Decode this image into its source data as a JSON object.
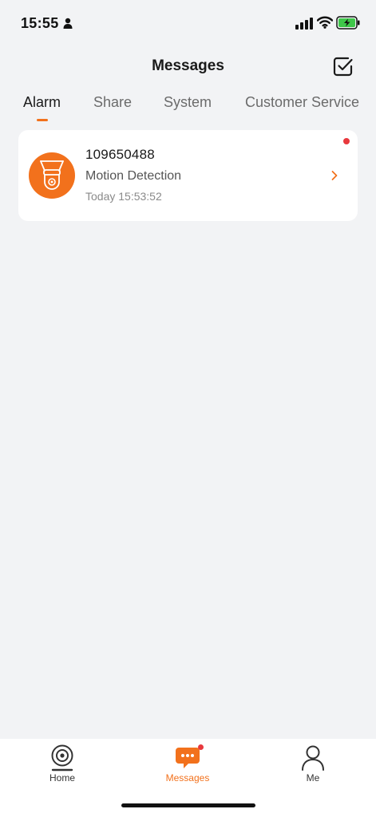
{
  "status_bar": {
    "time": "15:55"
  },
  "header": {
    "title": "Messages"
  },
  "tabs": [
    {
      "label": "Alarm",
      "active": true
    },
    {
      "label": "Share",
      "active": false
    },
    {
      "label": "System",
      "active": false
    },
    {
      "label": "Customer Service",
      "active": false
    }
  ],
  "messages": [
    {
      "device_id": "109650488",
      "event": "Motion Detection",
      "time": "Today 15:53:52",
      "unread": true
    }
  ],
  "tabbar": {
    "items": [
      {
        "label": "Home",
        "icon": "camera-icon",
        "active": false
      },
      {
        "label": "Messages",
        "icon": "chat-bubble-icon",
        "active": true,
        "badge": true
      },
      {
        "label": "Me",
        "icon": "person-icon",
        "active": false
      }
    ]
  },
  "colors": {
    "accent": "#f2711c",
    "badge": "#e8383d",
    "background": "#f2f3f5",
    "battery": "#3fc74a"
  }
}
